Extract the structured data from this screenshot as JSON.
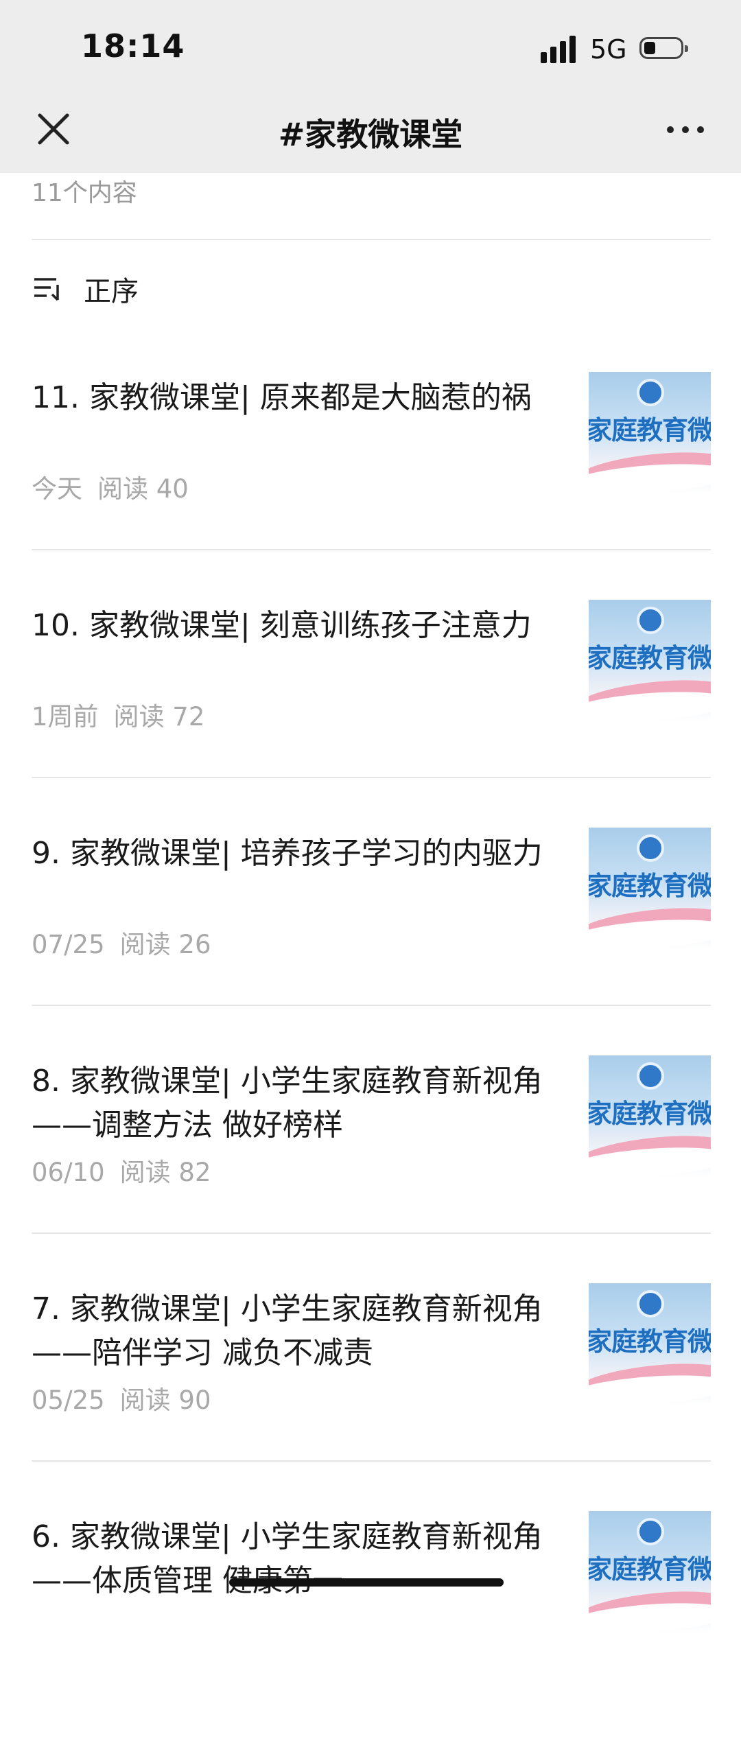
{
  "status_bar": {
    "time": "18:14",
    "network": "5G"
  },
  "nav": {
    "title": "#家教微课堂"
  },
  "collection": {
    "count_text": "11个内容",
    "sort_label": "正序"
  },
  "thumb_text": "家庭教育微课",
  "articles": [
    {
      "title": "11. 家教微课堂| 原来都是大脑惹的祸",
      "date": "今天",
      "reads": "阅读 40"
    },
    {
      "title": "10. 家教微课堂| 刻意训练孩子注意力",
      "date": "1周前",
      "reads": "阅读 72"
    },
    {
      "title": "9. 家教微课堂| 培养孩子学习的内驱力",
      "date": "07/25",
      "reads": "阅读 26"
    },
    {
      "title": "8. 家教微课堂| 小学生家庭教育新视角——调整方法 做好榜样",
      "date": "06/10",
      "reads": "阅读 82"
    },
    {
      "title": "7. 家教微课堂| 小学生家庭教育新视角——陪伴学习 减负不减责",
      "date": "05/25",
      "reads": "阅读 90"
    },
    {
      "title": "6. 家教微课堂| 小学生家庭教育新视角——体质管理 健康第一",
      "date": "",
      "reads": ""
    }
  ]
}
